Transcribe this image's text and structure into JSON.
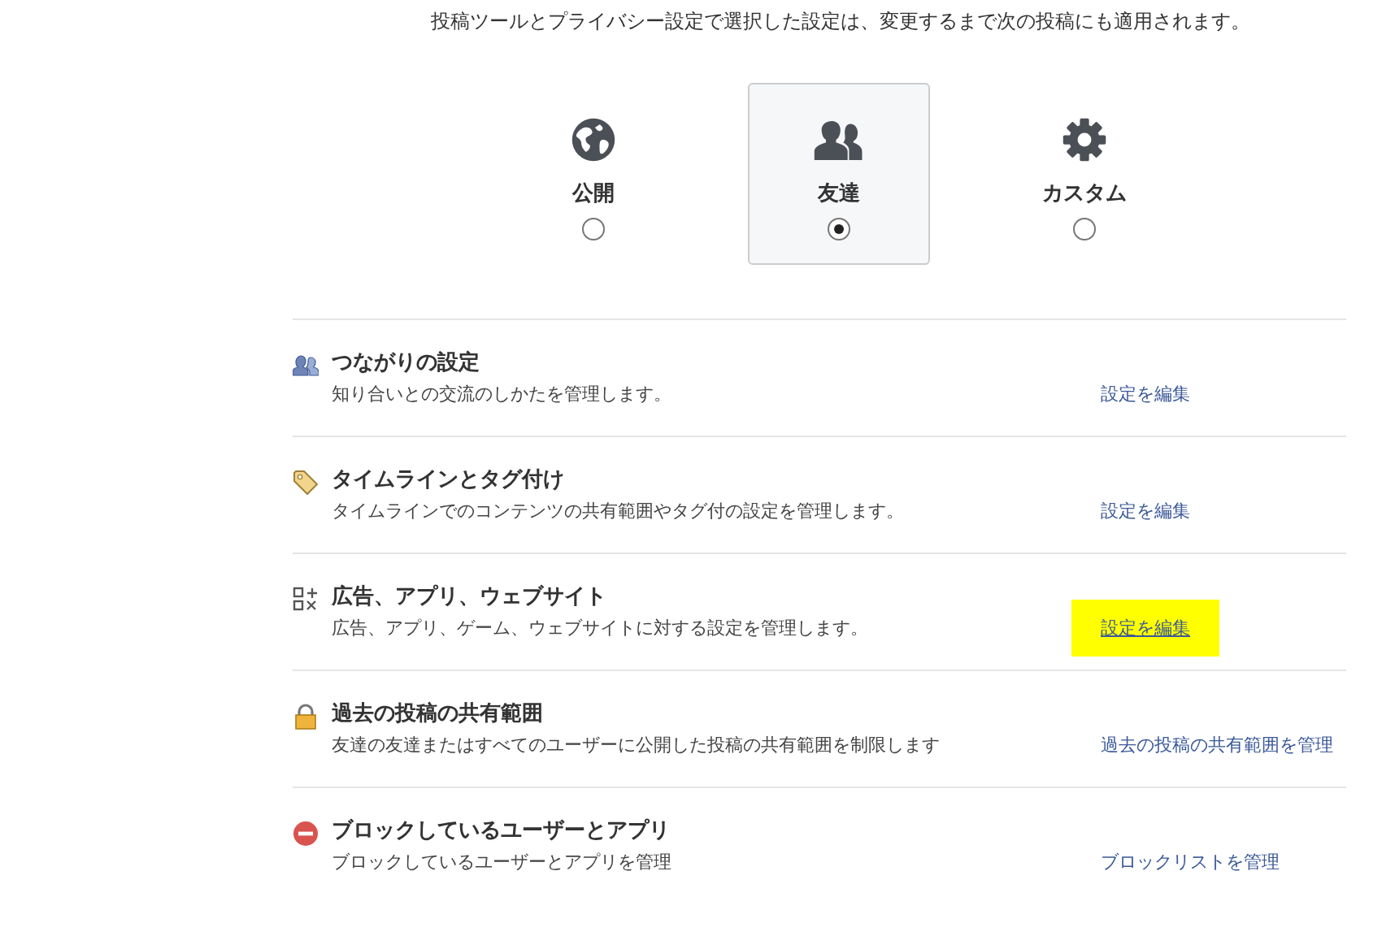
{
  "intro": "投稿ツールとプライバシー設定で選択した設定は、変更するまで次の投稿にも適用されます。",
  "audience": [
    {
      "label": "公開",
      "selected": false
    },
    {
      "label": "友達",
      "selected": true
    },
    {
      "label": "カスタム",
      "selected": false
    }
  ],
  "settings": [
    {
      "title": "つながりの設定",
      "description": "知り合いとの交流のしかたを管理します。",
      "link": "設定を編集",
      "highlighted": false
    },
    {
      "title": "タイムラインとタグ付け",
      "description": "タイムラインでのコンテンツの共有範囲やタグ付の設定を管理します。",
      "link": "設定を編集",
      "highlighted": false
    },
    {
      "title": "広告、アプリ、ウェブサイト",
      "description": "広告、アプリ、ゲーム、ウェブサイトに対する設定を管理します。",
      "link": "設定を編集",
      "highlighted": true
    },
    {
      "title": "過去の投稿の共有範囲",
      "description": "友達の友達またはすべてのユーザーに公開した投稿の共有範囲を制限します",
      "link": "過去の投稿の共有範囲を管理",
      "highlighted": false
    },
    {
      "title": "ブロックしているユーザーとアプリ",
      "description": "ブロックしているユーザーとアプリを管理",
      "link": "ブロックリストを管理",
      "highlighted": false
    }
  ]
}
